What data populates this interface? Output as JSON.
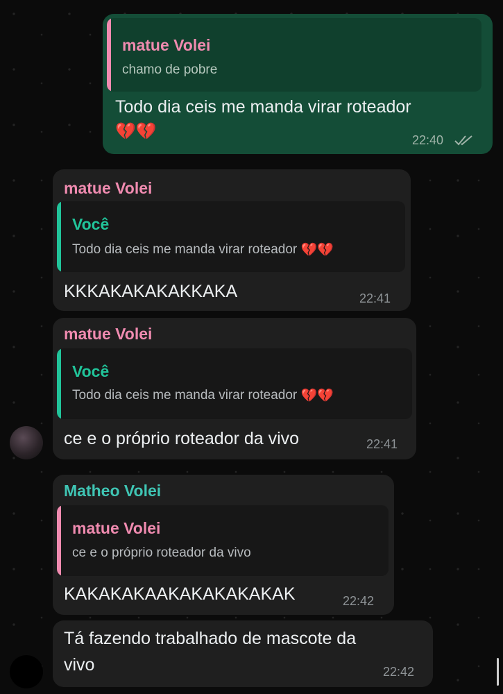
{
  "colors": {
    "outgoing_bubble": "#144d37",
    "incoming_bubble": "#1f1f1f",
    "name_pink": "#f08bb0",
    "name_teal": "#3fc5b4",
    "you_green": "#21c49a"
  },
  "messages": [
    {
      "sender": "",
      "quote_name": "matue Volei",
      "quote_text": "chamo de pobre",
      "text": "Todo dia ceis me manda virar roteador",
      "emoji": "💔💔",
      "time": "22:40",
      "status_icon": "double-check-icon"
    },
    {
      "sender": "matue Volei",
      "quote_name": "Você",
      "quote_text": "Todo dia ceis me manda virar roteador",
      "quote_emoji": "💔💔",
      "text": "KKKAKAKAKAKKAKA",
      "time": "22:41"
    },
    {
      "sender": "matue Volei",
      "quote_name": "Você",
      "quote_text": "Todo dia ceis me manda virar roteador",
      "quote_emoji": "💔💔",
      "text": "ce e o próprio roteador da vivo",
      "time": "22:41"
    },
    {
      "sender": "Matheo Volei",
      "quote_name": "matue Volei",
      "quote_text": "ce e o próprio roteador da vivo",
      "text": "KAKAKAKAAKAKAKAKAKAK",
      "time": "22:42"
    },
    {
      "sender": "",
      "text_line1": "Tá fazendo trabalhado de mascote da",
      "text_line2": "vivo",
      "time": "22:42"
    }
  ]
}
